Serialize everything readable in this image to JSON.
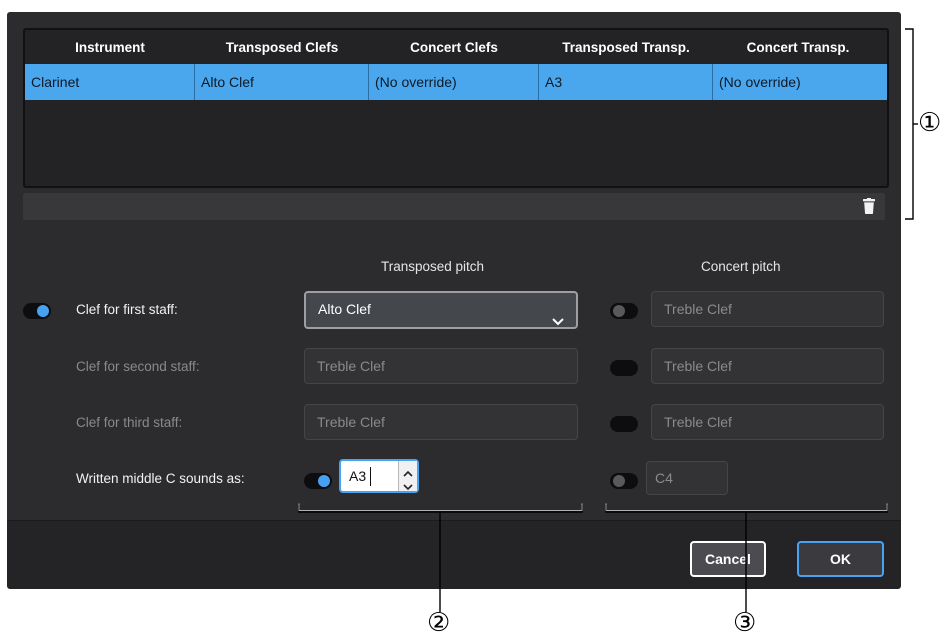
{
  "table": {
    "columns": [
      "Instrument",
      "Transposed Clefs",
      "Concert Clefs",
      "Transposed Transp.",
      "Concert Transp."
    ],
    "rows": [
      [
        "Clarinet",
        "Alto Clef",
        "(No override)",
        "A3",
        "(No override)"
      ]
    ]
  },
  "headings": {
    "transposed": "Transposed pitch",
    "concert": "Concert pitch"
  },
  "rows": {
    "first": {
      "label": "Clef for first staff:",
      "transposed": "Alto Clef",
      "concert": "Treble Clef"
    },
    "second": {
      "label": "Clef for second staff:",
      "transposed": "Treble Clef",
      "concert": "Treble Clef"
    },
    "third": {
      "label": "Clef for third staff:",
      "transposed": "Treble Clef",
      "concert": "Treble Clef"
    },
    "middle_c": {
      "label": "Written middle C sounds as:",
      "transposed": "A3",
      "concert": "C4"
    }
  },
  "buttons": {
    "cancel": "Cancel",
    "ok": "OK"
  },
  "callouts": {
    "c1": "①",
    "c2": "②",
    "c3": "③"
  },
  "colors": {
    "accent": "#4aa7ee",
    "dialog_bg": "#2c2c2e"
  },
  "icons": {
    "delete": "trash-icon",
    "dropdown": "chevron-down-icon"
  }
}
